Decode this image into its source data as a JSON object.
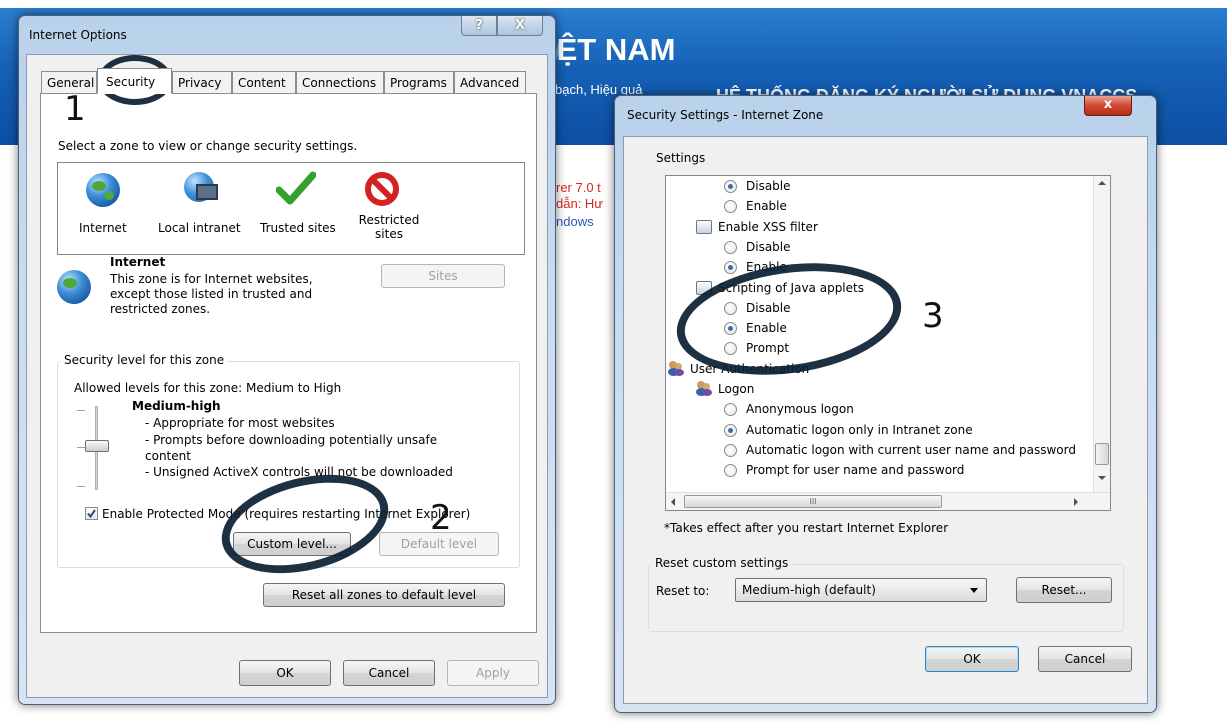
{
  "webpage": {
    "banner_title": "IỆT NAM",
    "banner_slogan": "bạch, Hiệu quả",
    "banner_system": "HỆ THỐNG ĐĂNG KÝ NGƯỜI SỬ DỤNG VNACCS",
    "line1": "rer 7.0 t",
    "line2": "dẫn: Hư",
    "line3": "ndows"
  },
  "internet_options": {
    "title": "Internet Options",
    "caption_help": "?",
    "caption_close": "X",
    "tabs": [
      "General",
      "Security",
      "Privacy",
      "Content",
      "Connections",
      "Programs",
      "Advanced"
    ],
    "prompt": "Select a zone to view or change security settings.",
    "zones": [
      {
        "label": "Internet",
        "icon": "globe-icon"
      },
      {
        "label": "Local intranet",
        "icon": "local-intranet-icon"
      },
      {
        "label": "Trusted sites",
        "icon": "checkmark-icon"
      },
      {
        "label": "Restricted sites",
        "icon": "no-entry-icon"
      }
    ],
    "zone_heading": "Internet",
    "zone_description": "This zone is for Internet websites, except those listed in trusted and restricted zones.",
    "sites_button": "Sites",
    "security_level_group": "Security level for this zone",
    "allowed_levels": "Allowed levels for this zone: Medium to High",
    "level_name": "Medium-high",
    "level_points": [
      "- Appropriate for most websites",
      "- Prompts before downloading potentially unsafe content",
      "- Unsigned ActiveX controls will not be downloaded"
    ],
    "protected_mode_label": "Enable Protected Mode (requires restarting Internet Explorer)",
    "protected_mode_checked": true,
    "custom_level_button": "Custom level...",
    "default_level_button": "Default level",
    "reset_all_button": "Reset all zones to default level",
    "ok_button": "OK",
    "cancel_button": "Cancel",
    "apply_button": "Apply"
  },
  "security_settings": {
    "title": "Security Settings - Internet Zone",
    "close_glyph": "x",
    "settings_label": "Settings",
    "tree": [
      {
        "kind": "option",
        "label": "Disable",
        "selected": true
      },
      {
        "kind": "option",
        "label": "Enable",
        "selected": false
      },
      {
        "kind": "setting",
        "label": "Enable XSS filter"
      },
      {
        "kind": "option",
        "label": "Disable",
        "selected": false
      },
      {
        "kind": "option",
        "label": "Enable",
        "selected": true
      },
      {
        "kind": "setting",
        "label": "Scripting of Java applets"
      },
      {
        "kind": "option",
        "label": "Disable",
        "selected": false
      },
      {
        "kind": "option",
        "label": "Enable",
        "selected": true
      },
      {
        "kind": "option",
        "label": "Prompt",
        "selected": false
      },
      {
        "kind": "category",
        "label": "User Authentication"
      },
      {
        "kind": "subcategory",
        "label": "Logon"
      },
      {
        "kind": "option2",
        "label": "Anonymous logon",
        "selected": false
      },
      {
        "kind": "option2",
        "label": "Automatic logon only in Intranet zone",
        "selected": true
      },
      {
        "kind": "option2",
        "label": "Automatic logon with current user name and password",
        "selected": false
      },
      {
        "kind": "option2",
        "label": "Prompt for user name and password",
        "selected": false
      }
    ],
    "hscroll_grip": "III",
    "footnote": "*Takes effect after you restart Internet Explorer",
    "reset_group": "Reset custom settings",
    "reset_to_label": "Reset to:",
    "reset_to_value": "Medium-high (default)",
    "reset_button": "Reset...",
    "ok_button": "OK",
    "cancel_button": "Cancel"
  },
  "annotations": [
    "1",
    "2",
    "3"
  ]
}
